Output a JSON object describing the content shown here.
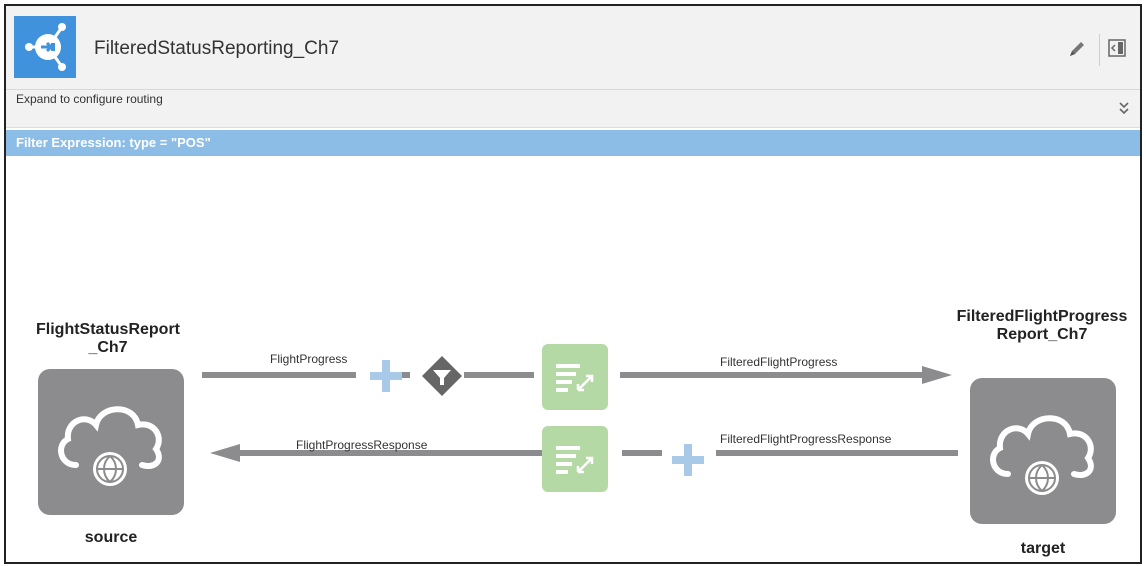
{
  "header": {
    "title": "FilteredStatusReporting_Ch7",
    "expand_text": "Expand to configure routing",
    "expand_glyph": "»"
  },
  "filter": {
    "expression": "Filter Expression: type = \"POS\""
  },
  "source": {
    "name": "FlightStatusReport_Ch7",
    "role": "source"
  },
  "target": {
    "name": "FilteredFlightProgressReport_Ch7",
    "role": "target"
  },
  "request_flow": {
    "source_label": "FlightProgress",
    "target_label": "FilteredFlightProgress"
  },
  "response_flow": {
    "source_label": "FlightProgressResponse",
    "target_label": "FilteredFlightProgressResponse"
  },
  "colors": {
    "header_icon": "#3f92db",
    "filter_bar": "#8cbde6",
    "node": "#8c8c8e",
    "map_tile": "#b5d9a4",
    "wire": "#8c8c8e",
    "plus": "#a9c9e8"
  }
}
